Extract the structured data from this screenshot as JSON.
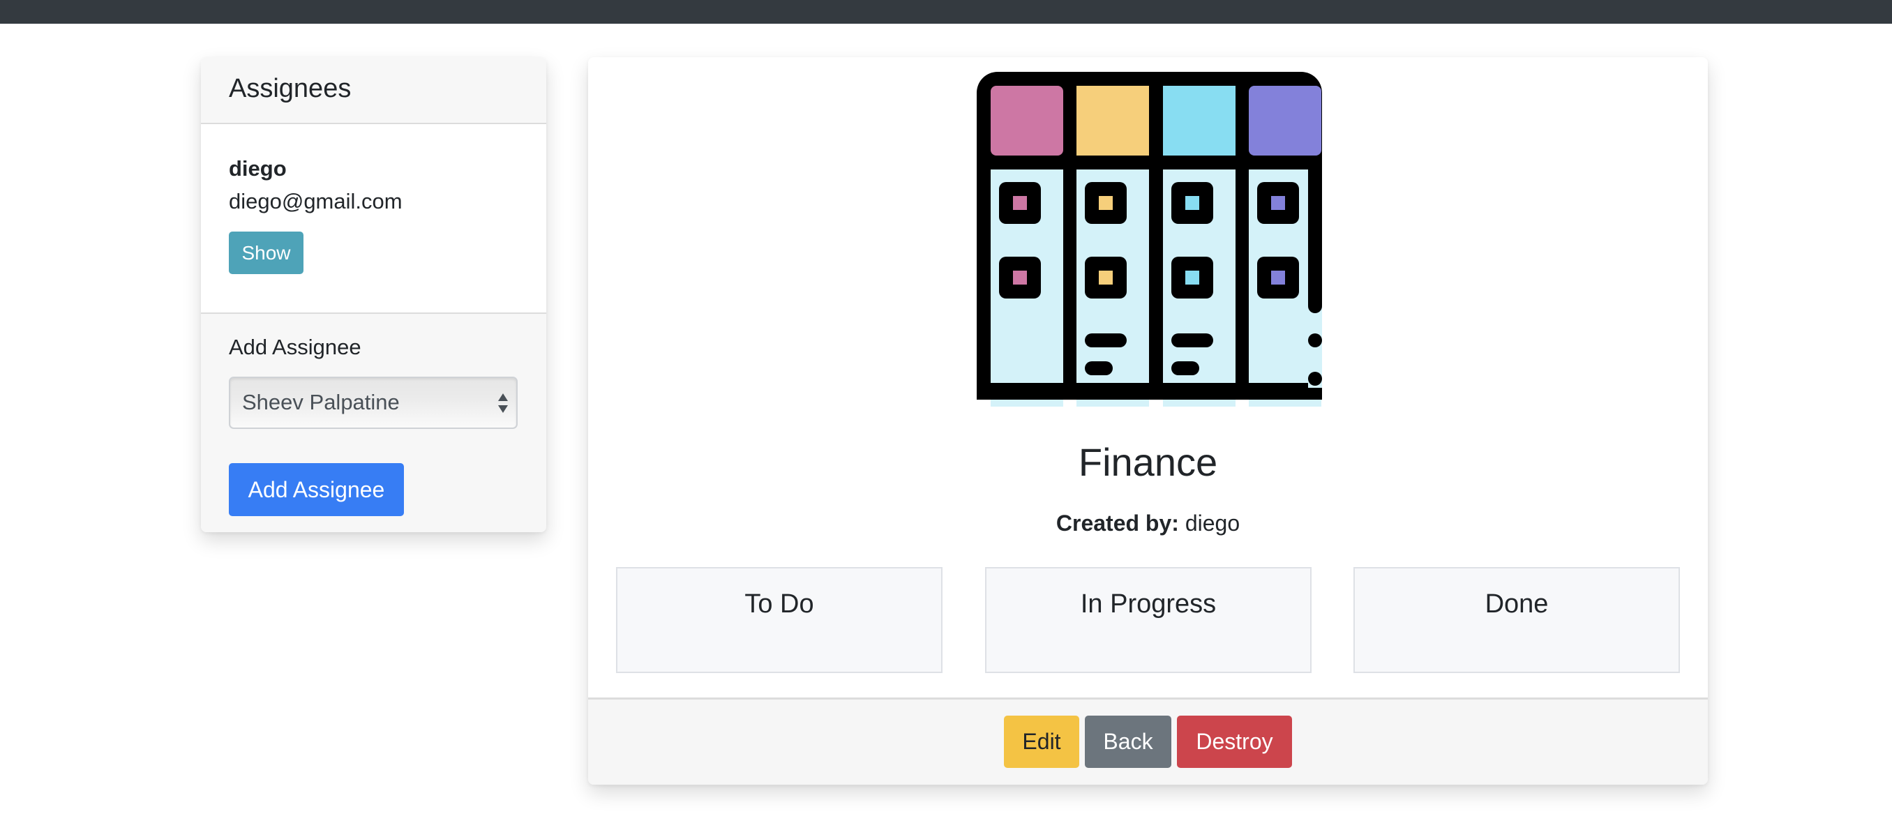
{
  "topbar": {
    "color": "#343a40"
  },
  "sidebar": {
    "title": "Assignees",
    "assignees": [
      {
        "name": "diego",
        "email": "diego@gmail.com",
        "show_label": "Show"
      }
    ],
    "add_section": {
      "label": "Add Assignee",
      "select_value": "Sheev Palpatine",
      "button_label": "Add Assignee"
    }
  },
  "board": {
    "icon": "kanban-board-icon",
    "icon_colors": {
      "pink": "#cd77a4",
      "yellow": "#f6cf7b",
      "cyan": "#88ddf2",
      "purple": "#8381da",
      "column_bg": "#d4f2f9"
    },
    "title": "Finance",
    "created_by_label": "Created by:",
    "created_by_value": "diego",
    "columns": [
      {
        "label": "To Do"
      },
      {
        "label": "In Progress"
      },
      {
        "label": "Done"
      }
    ],
    "actions": {
      "edit_label": "Edit",
      "back_label": "Back",
      "destroy_label": "Destroy"
    }
  },
  "colors": {
    "info": "#4ea3b8",
    "primary": "#377df4",
    "warning": "#f4c344",
    "secondary": "#6c757d",
    "danger": "#cc454c"
  }
}
